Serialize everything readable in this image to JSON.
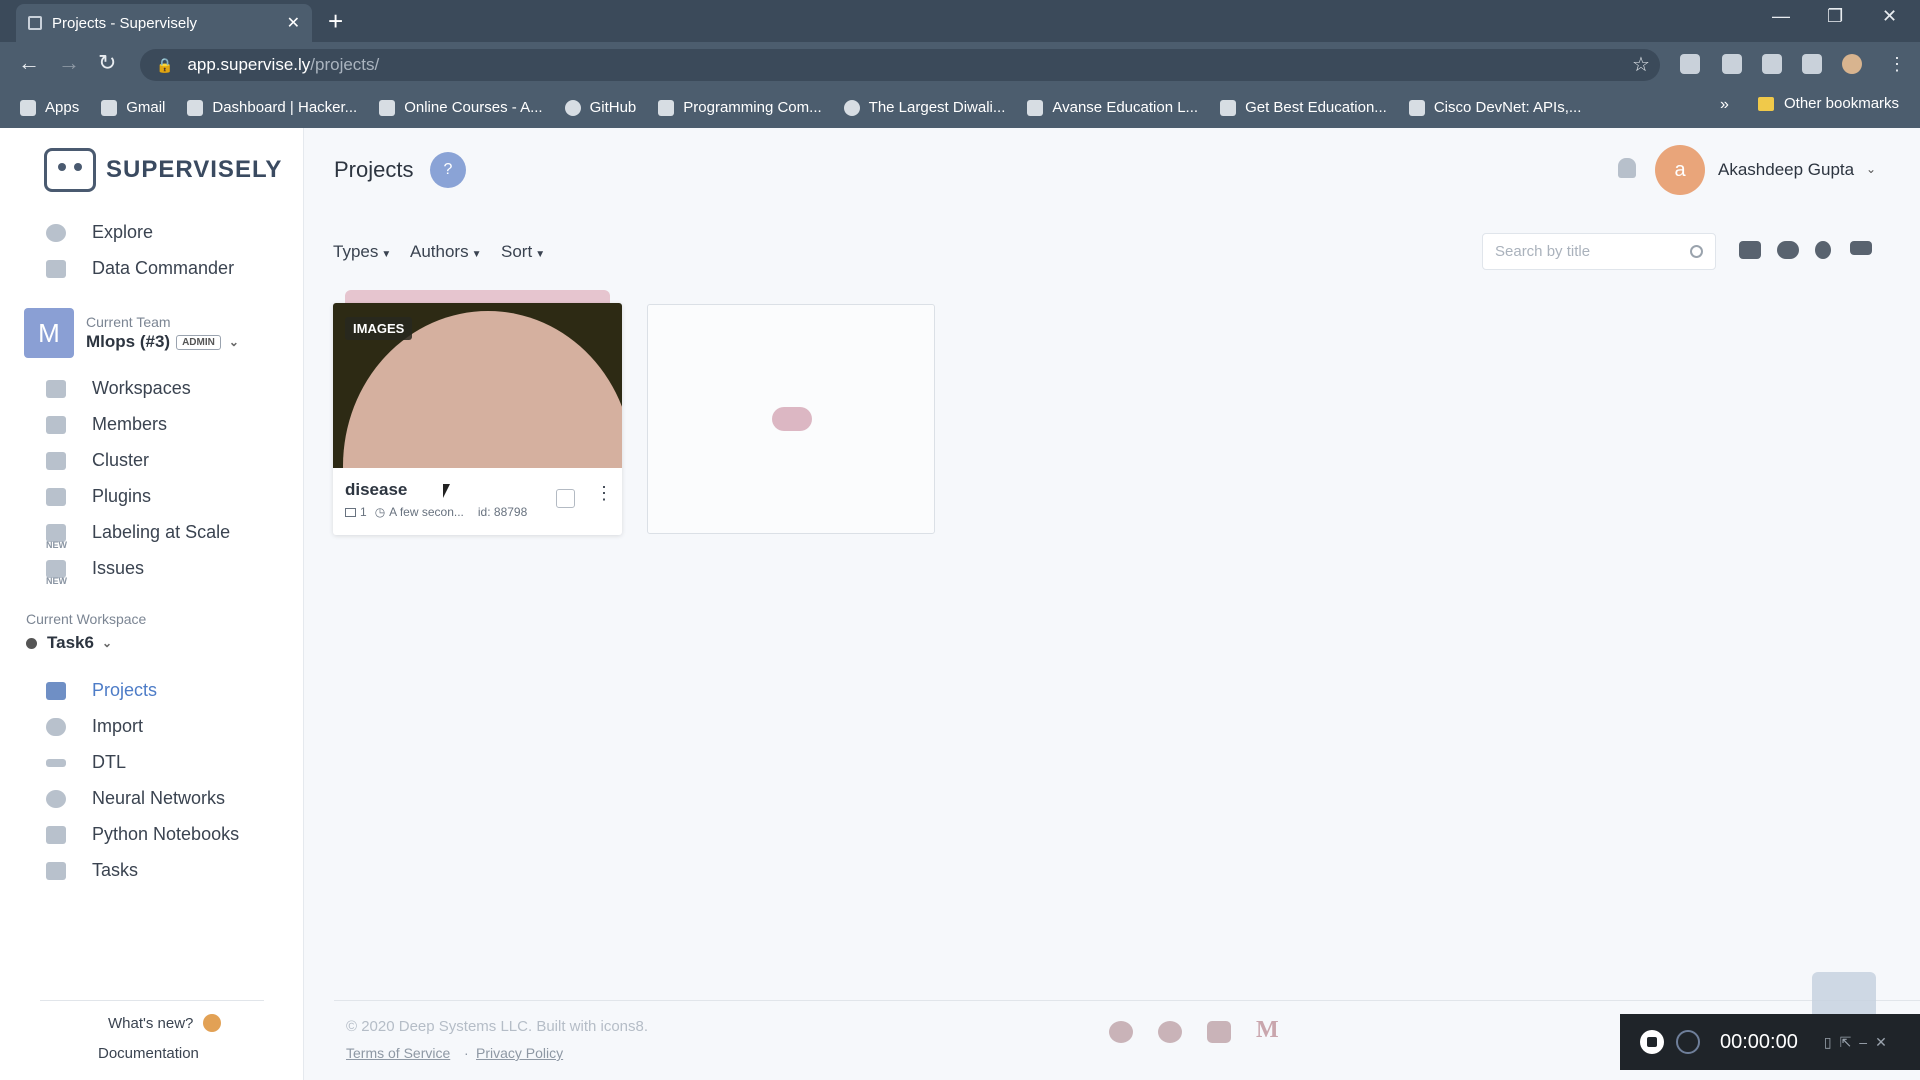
{
  "browser": {
    "tab_title": "Projects - Supervisely",
    "url_host": "app.supervise.ly",
    "url_path": "/projects/",
    "bookmarks": [
      "Apps",
      "Gmail",
      "Dashboard | Hacker...",
      "Online Courses - A...",
      "GitHub",
      "Programming Com...",
      "The Largest Diwali...",
      "Avanse Education L...",
      "Get Best Education...",
      "Cisco DevNet: APIs,..."
    ],
    "other_bookmarks": "Other bookmarks"
  },
  "sidebar": {
    "logo_text": "SUPERVISELY",
    "top_items": [
      "Explore",
      "Data Commander"
    ],
    "team_label": "Current Team",
    "team_initial": "M",
    "team_name": "Mlops (#3)",
    "team_role": "ADMIN",
    "team_items": [
      "Workspaces",
      "Members",
      "Cluster",
      "Plugins",
      "Labeling at Scale",
      "Issues"
    ],
    "new_tag": "NEW",
    "workspace_label": "Current Workspace",
    "workspace_name": "Task6",
    "workspace_items": [
      "Projects",
      "Import",
      "DTL",
      "Neural Networks",
      "Python Notebooks",
      "Tasks"
    ],
    "whats_new": "What's new?",
    "documentation": "Documentation"
  },
  "header": {
    "title": "Projects",
    "help": "?",
    "user_initial": "a",
    "user_name": "Akashdeep Gupta"
  },
  "filters": {
    "types": "Types",
    "authors": "Authors",
    "sort": "Sort",
    "search_placeholder": "Search by title"
  },
  "project": {
    "tag": "IMAGES",
    "name": "disease",
    "datasets": "1",
    "updated": "A few secon...",
    "id": "id: 88798"
  },
  "footer": {
    "copyright": "© 2020 Deep Systems LLC. Built with icons8.",
    "terms": "Terms of Service",
    "sep": "·",
    "privacy": "Privacy Policy",
    "medium": "M"
  },
  "recorder": {
    "time": "00:00:00"
  }
}
